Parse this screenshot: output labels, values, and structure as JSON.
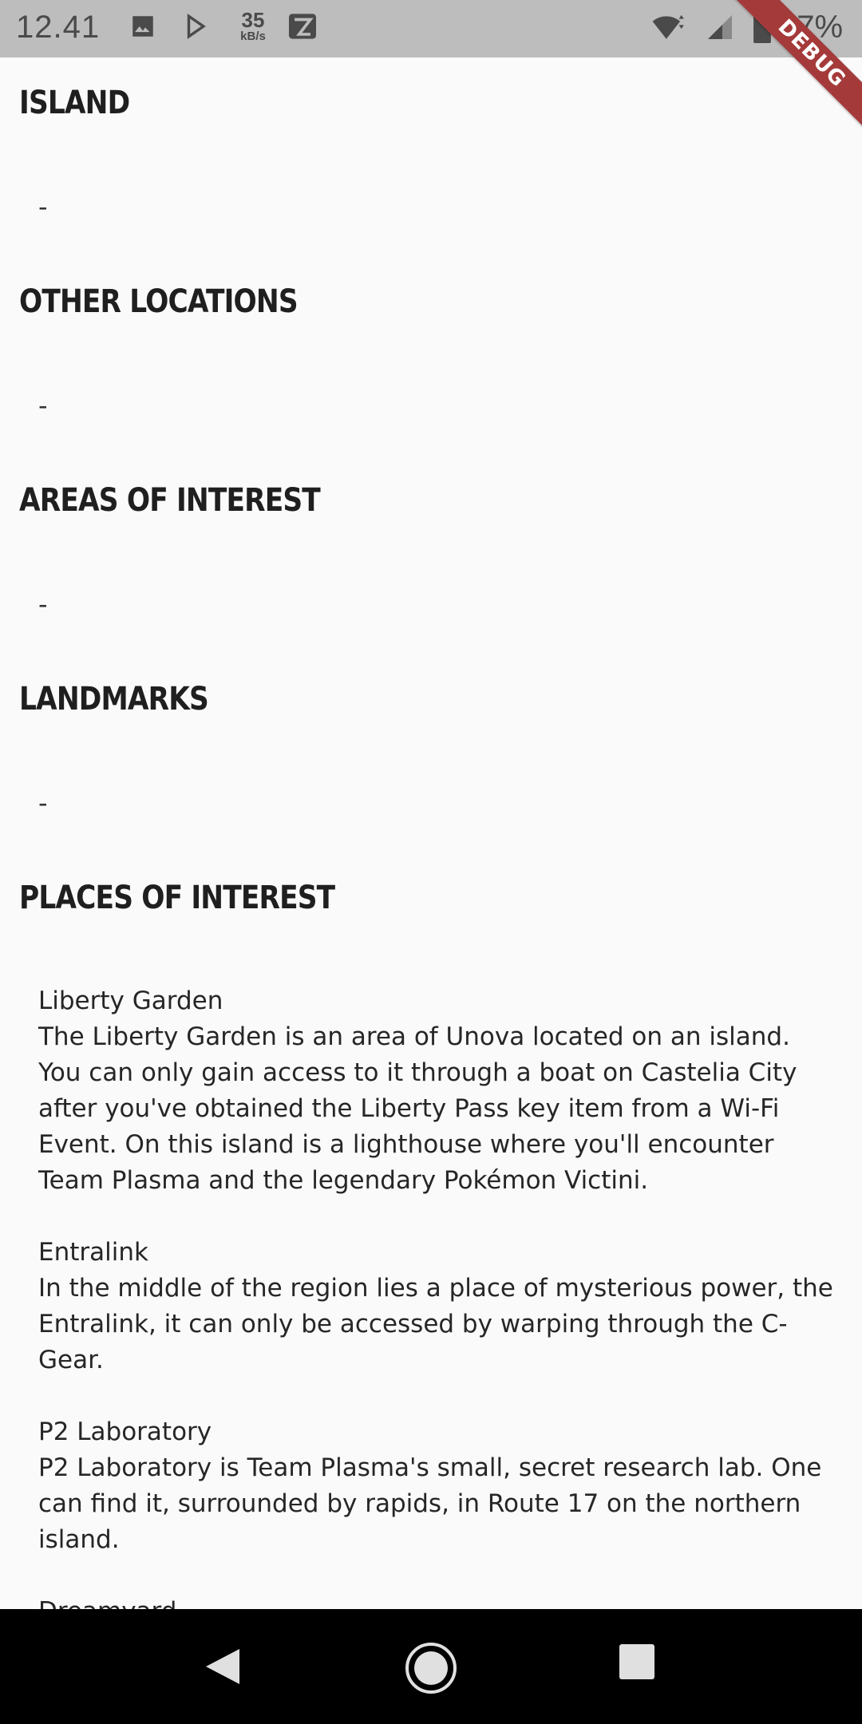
{
  "status_bar": {
    "time": "12.41",
    "net_speed_value": "35",
    "net_speed_unit": "kB/s",
    "battery_percent": "97%",
    "icons": [
      "image-icon",
      "play-store-icon",
      "app-icon",
      "wifi-icon",
      "signal-icon",
      "battery-icon"
    ]
  },
  "debug_banner": "DEBUG",
  "sections": {
    "island": {
      "title": "ISLAND",
      "value": "-"
    },
    "other_locations": {
      "title": "OTHER LOCATIONS",
      "value": "-"
    },
    "areas_of_interest": {
      "title": "AREAS OF INTEREST",
      "value": "-"
    },
    "landmarks": {
      "title": "LANDMARKS",
      "value": "-"
    },
    "places_of_interest": {
      "title": "PLACES OF INTEREST",
      "places": [
        {
          "name": "Liberty Garden",
          "description": "The Liberty Garden is an area of Unova located on an island. You can only gain access to it through a boat on Castelia City after you've obtained the Liberty Pass key item from a Wi-Fi Event. On this island is a lighthouse where you'll encounter Team Plasma and the legendary Pokémon Victini."
        },
        {
          "name": "Entralink",
          "description": "In the middle of the region lies a place of mysterious power, the Entralink, it can only be accessed by warping through the C-Gear."
        },
        {
          "name": "P2 Laboratory",
          "description": "P2 Laboratory is Team Plasma's small, secret research lab. One can find it, surrounded by rapids, in Route 17 on the northern island."
        },
        {
          "name": "Dreamyard",
          "description": ""
        }
      ]
    }
  },
  "nav_bar": {
    "buttons": [
      "back-icon",
      "home-icon",
      "recents-icon"
    ]
  }
}
